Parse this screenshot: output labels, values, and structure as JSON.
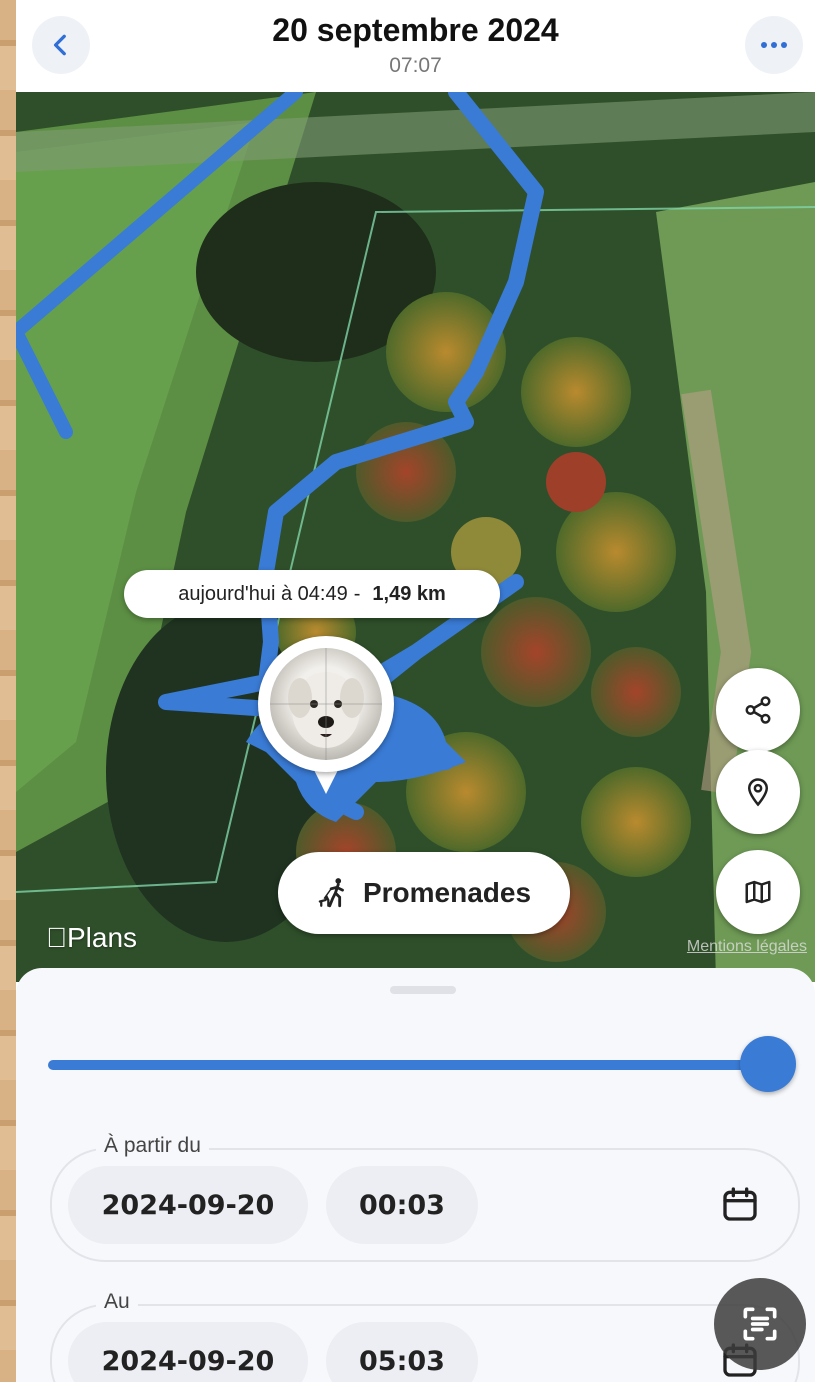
{
  "header": {
    "title": "20 septembre 2024",
    "subtitle": "07:07",
    "back_icon": "chevron-left-icon",
    "more_icon": "more-horizontal-icon"
  },
  "map": {
    "tooltip_prefix": "aujourd'hui à 04:49",
    "tooltip_separator": "-",
    "tooltip_distance": "1,49 km",
    "walks_button_label": "Promenades",
    "walks_icon": "dog-walker-icon",
    "attribution_logo": "Plans",
    "legal_link": "Mentions légales",
    "side_buttons": [
      "share-icon",
      "location-pin-icon",
      "map-icon"
    ],
    "route_color": "#3a7bd5"
  },
  "sheet": {
    "slider_value": 1.0,
    "from": {
      "label": "À partir du",
      "date": "2024-09-20",
      "time": "00:03"
    },
    "to": {
      "label": "Au",
      "date": "2024-09-20",
      "time": "05:03"
    }
  }
}
